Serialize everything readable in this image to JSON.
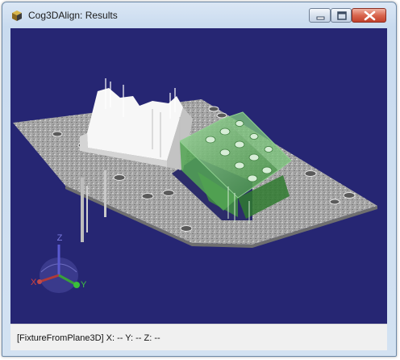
{
  "window": {
    "title": "Cog3DAlign: Results"
  },
  "viewport": {
    "background_color": "#262673",
    "axes": {
      "x_label": "X",
      "y_label": "Y",
      "z_label": "Z"
    }
  },
  "status": {
    "text": "[FixtureFromPlane3D]  X: --   Y: --   Z: --"
  },
  "colors": {
    "plate": "#a9a9a9",
    "reference_model": "#ffffff",
    "aligned_model": "#5fa35f"
  }
}
